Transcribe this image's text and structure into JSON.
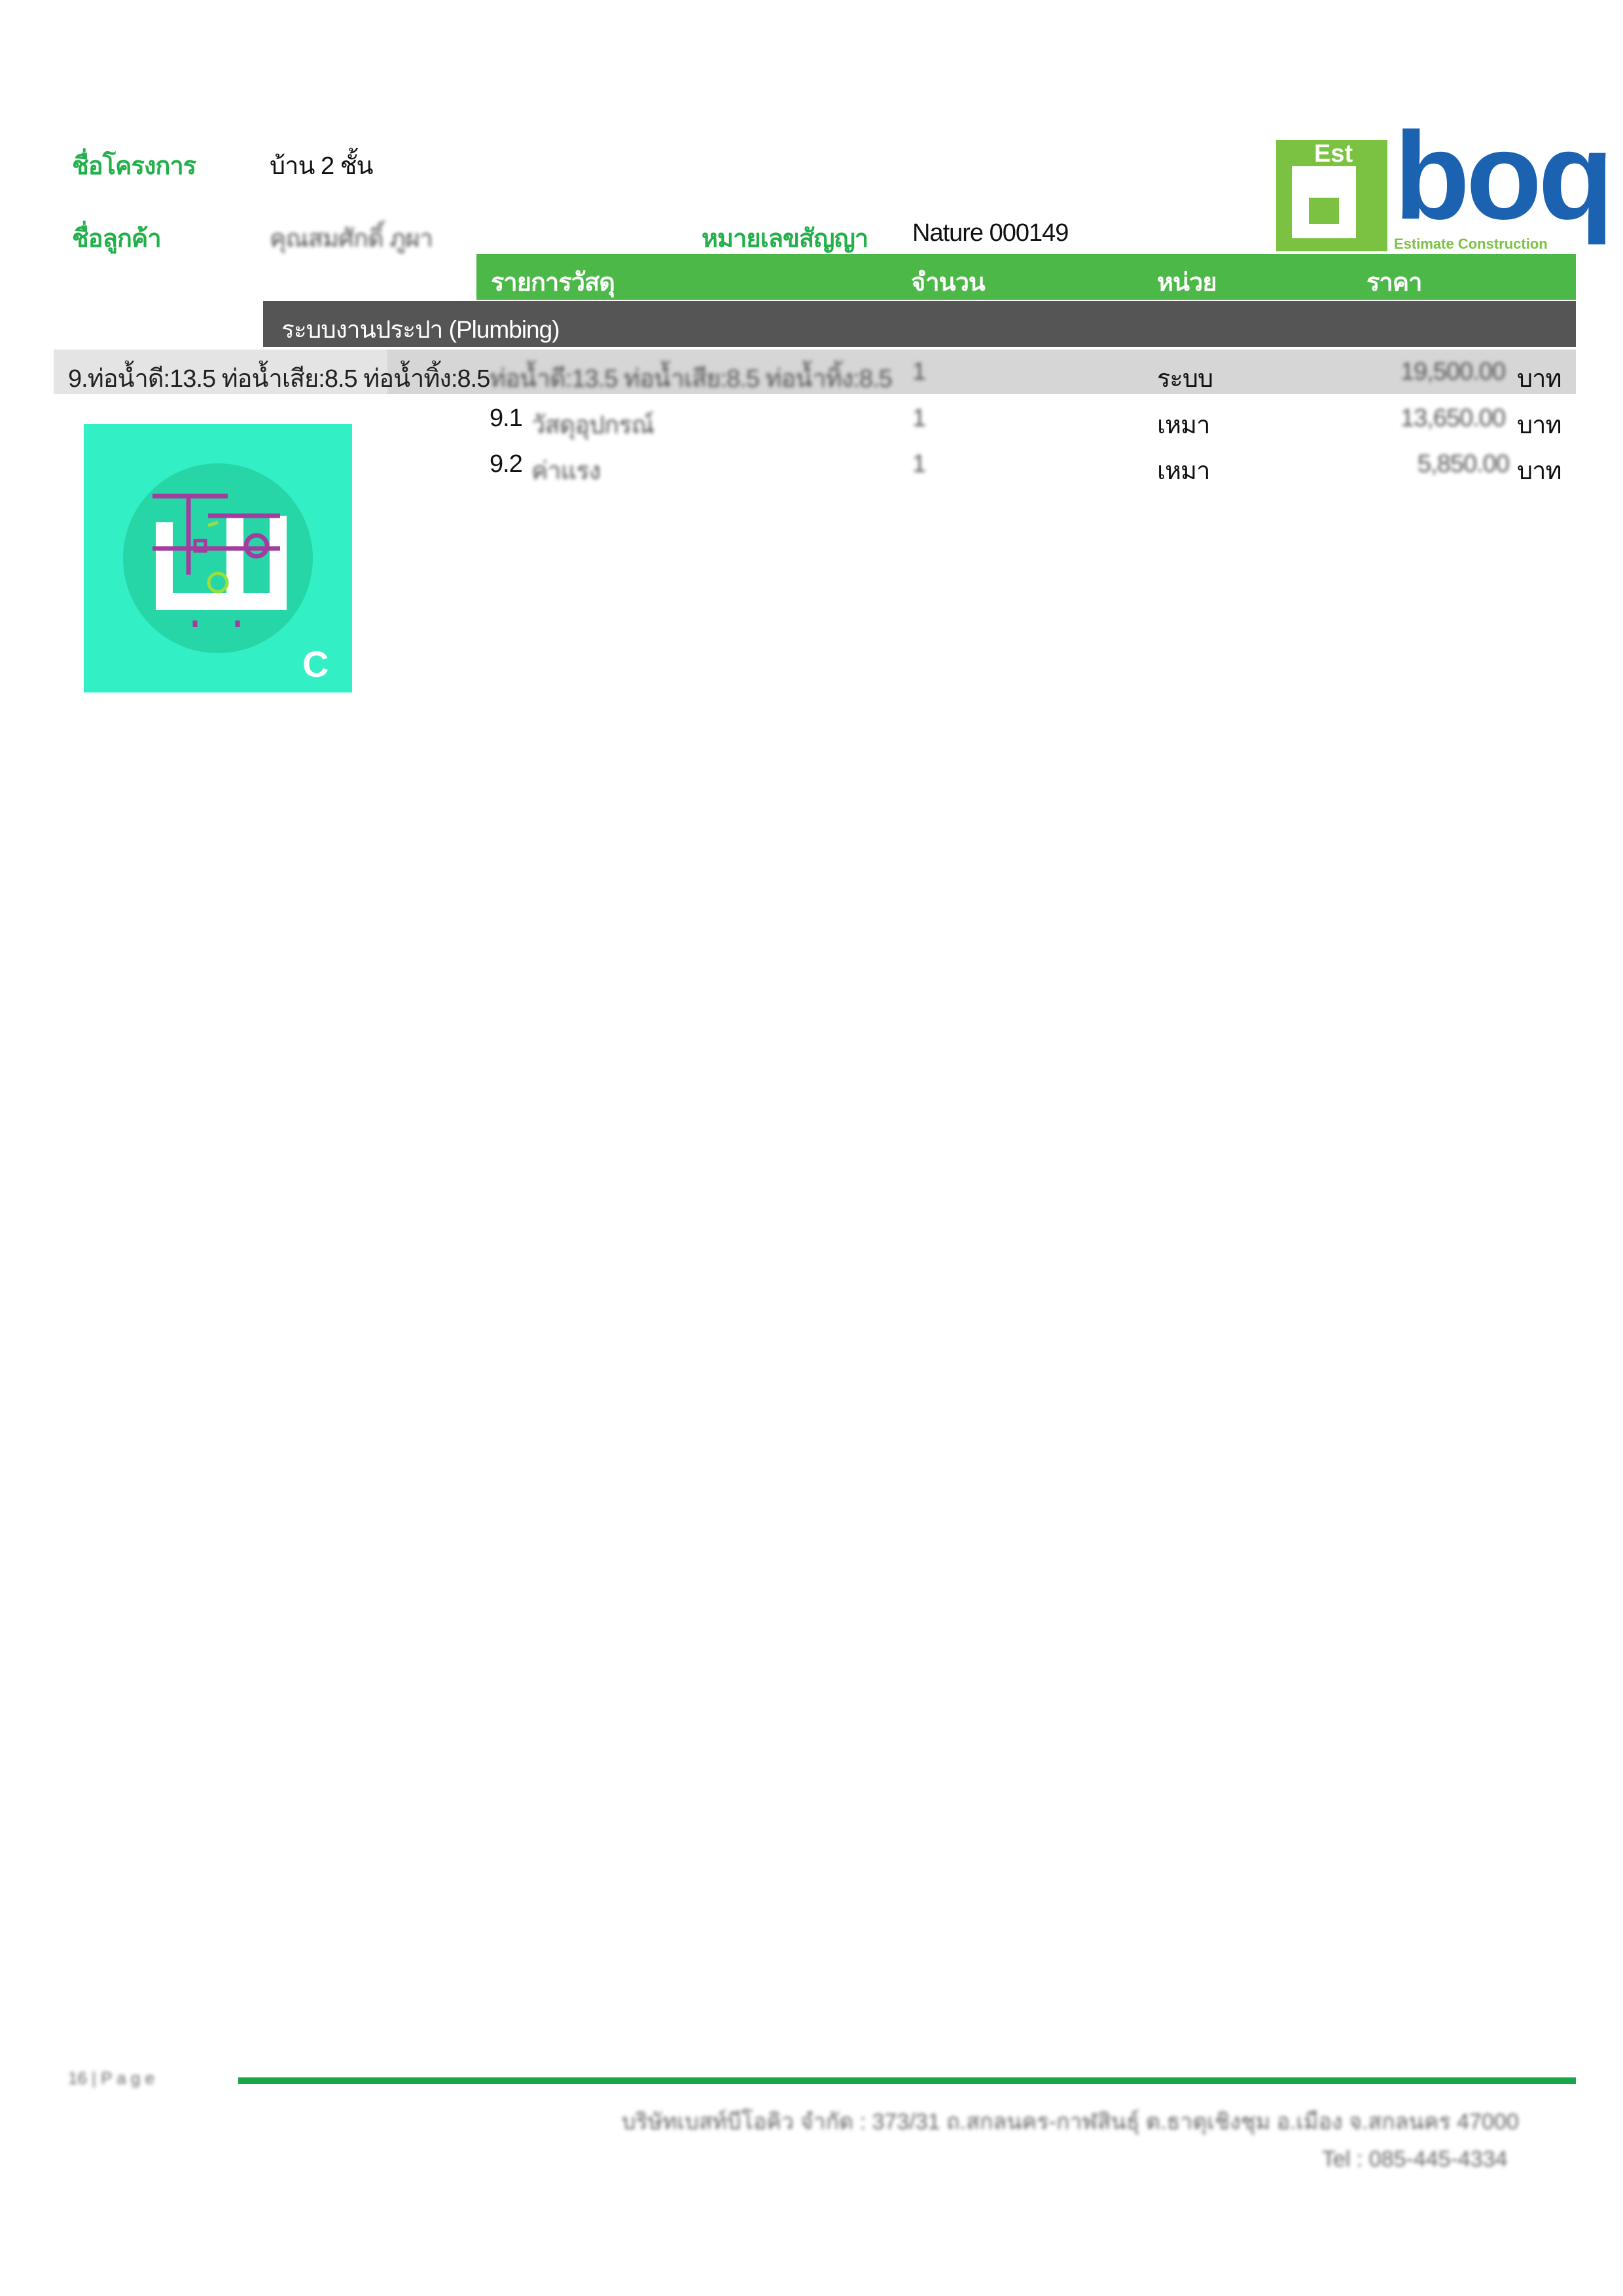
{
  "header": {
    "project_label": "ชื่อโครงการ",
    "project_value": "บ้าน 2 ชั้น",
    "customer_label": "ชื่อลูกค้า",
    "customer_value": "คุณสมศักดิ์ ภูผา",
    "contract_label": "หมายเลขสัญญา",
    "contract_value": "Nature 000149"
  },
  "logo": {
    "box_text": "Est",
    "letter": "b",
    "word": "boq",
    "tagline": "Estimate Construction",
    "colors": {
      "green": "#7cc242",
      "blue": "#1b62b0"
    }
  },
  "table": {
    "headers": [
      "รายการวัสดุ",
      "จำนวน",
      "หน่วย",
      "ราคา"
    ],
    "section_title": "ระบบงานประปา (Plumbing)",
    "group_row": {
      "left_label": "9.ท่อน้ำดี:13.5 ท่อน้ำเสีย:8.5 ท่อน้ำทิ้ง:8.5",
      "item": "ท่อน้ำดี:13.5 ท่อน้ำเสีย:8.5 ท่อน้ำทิ้ง:8.5",
      "qty": "1",
      "unit": "ระบบ",
      "price": "19,500.00",
      "currency": "บาท"
    },
    "rows": [
      {
        "no": "9.1",
        "item": "วัสดุอุปกรณ์",
        "qty": "1",
        "unit": "เหมา",
        "price": "13,650.00",
        "currency": "บาท"
      },
      {
        "no": "9.2",
        "item": "ค่าแรง",
        "qty": "1",
        "unit": "เหมา",
        "price": "5,850.00",
        "currency": "บาท"
      }
    ]
  },
  "icon_tile": {
    "name": "plumbing-icon",
    "letter": "C",
    "bg": "#33efc6"
  },
  "footer": {
    "page": "16 | P a g e",
    "address": "บริษัทเบสท์บีโอคิว จำกัด : 373/31 ถ.สกลนคร-กาฬสินธุ์ ต.ธาตุเชิงชุม อ.เมือง จ.สกลนคร 47000",
    "tel": "Tel : 085-445-4334"
  }
}
